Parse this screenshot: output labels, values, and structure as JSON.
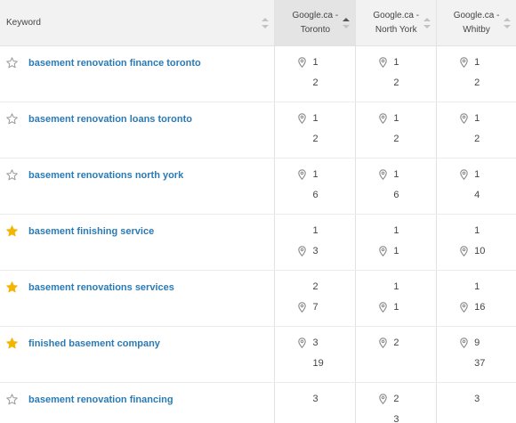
{
  "header": {
    "keyword_label": "Keyword",
    "locations": [
      {
        "line1": "Google.ca -",
        "line2": "Toronto",
        "sorted": true
      },
      {
        "line1": "Google.ca -",
        "line2": "North York",
        "sorted": false
      },
      {
        "line1": "Google.ca -",
        "line2": "Whitby",
        "sorted": false
      }
    ]
  },
  "colors": {
    "keyword_link": "#2a7ab5",
    "star_filled": "#f5b400",
    "star_empty": "#9a9a9a",
    "pin": "#8a8a8a"
  },
  "rows": [
    {
      "keyword": "basement renovation finance toronto",
      "starred": false,
      "cells": [
        {
          "l1": "1",
          "l1_pin": true,
          "l2": "2",
          "l2_pin": false
        },
        {
          "l1": "1",
          "l1_pin": true,
          "l2": "2",
          "l2_pin": false
        },
        {
          "l1": "1",
          "l1_pin": true,
          "l2": "2",
          "l2_pin": false
        }
      ]
    },
    {
      "keyword": "basement renovation loans toronto",
      "starred": false,
      "cells": [
        {
          "l1": "1",
          "l1_pin": true,
          "l2": "2",
          "l2_pin": false
        },
        {
          "l1": "1",
          "l1_pin": true,
          "l2": "2",
          "l2_pin": false
        },
        {
          "l1": "1",
          "l1_pin": true,
          "l2": "2",
          "l2_pin": false
        }
      ]
    },
    {
      "keyword": "basement renovations north york",
      "starred": false,
      "cells": [
        {
          "l1": "1",
          "l1_pin": true,
          "l2": "6",
          "l2_pin": false
        },
        {
          "l1": "1",
          "l1_pin": true,
          "l2": "6",
          "l2_pin": false
        },
        {
          "l1": "1",
          "l1_pin": true,
          "l2": "4",
          "l2_pin": false
        }
      ]
    },
    {
      "keyword": "basement finishing service",
      "starred": true,
      "cells": [
        {
          "l1": "1",
          "l1_pin": false,
          "l2": "3",
          "l2_pin": true
        },
        {
          "l1": "1",
          "l1_pin": false,
          "l2": "1",
          "l2_pin": true
        },
        {
          "l1": "1",
          "l1_pin": false,
          "l2": "10",
          "l2_pin": true
        }
      ]
    },
    {
      "keyword": "basement renovations services",
      "starred": true,
      "cells": [
        {
          "l1": "2",
          "l1_pin": false,
          "l2": "7",
          "l2_pin": true
        },
        {
          "l1": "1",
          "l1_pin": false,
          "l2": "1",
          "l2_pin": true
        },
        {
          "l1": "1",
          "l1_pin": false,
          "l2": "16",
          "l2_pin": true
        }
      ]
    },
    {
      "keyword": "finished basement company",
      "starred": true,
      "cells": [
        {
          "l1": "3",
          "l1_pin": true,
          "l2": "19",
          "l2_pin": false
        },
        {
          "l1": "2",
          "l1_pin": true,
          "l2": "",
          "l2_pin": false
        },
        {
          "l1": "9",
          "l1_pin": true,
          "l2": "37",
          "l2_pin": false
        }
      ]
    },
    {
      "keyword": "basement renovation financing",
      "starred": false,
      "cells": [
        {
          "l1": "3",
          "l1_pin": false,
          "l2": "",
          "l2_pin": false
        },
        {
          "l1": "2",
          "l1_pin": true,
          "l2": "3",
          "l2_pin": false
        },
        {
          "l1": "3",
          "l1_pin": false,
          "l2": "",
          "l2_pin": false
        }
      ]
    }
  ]
}
